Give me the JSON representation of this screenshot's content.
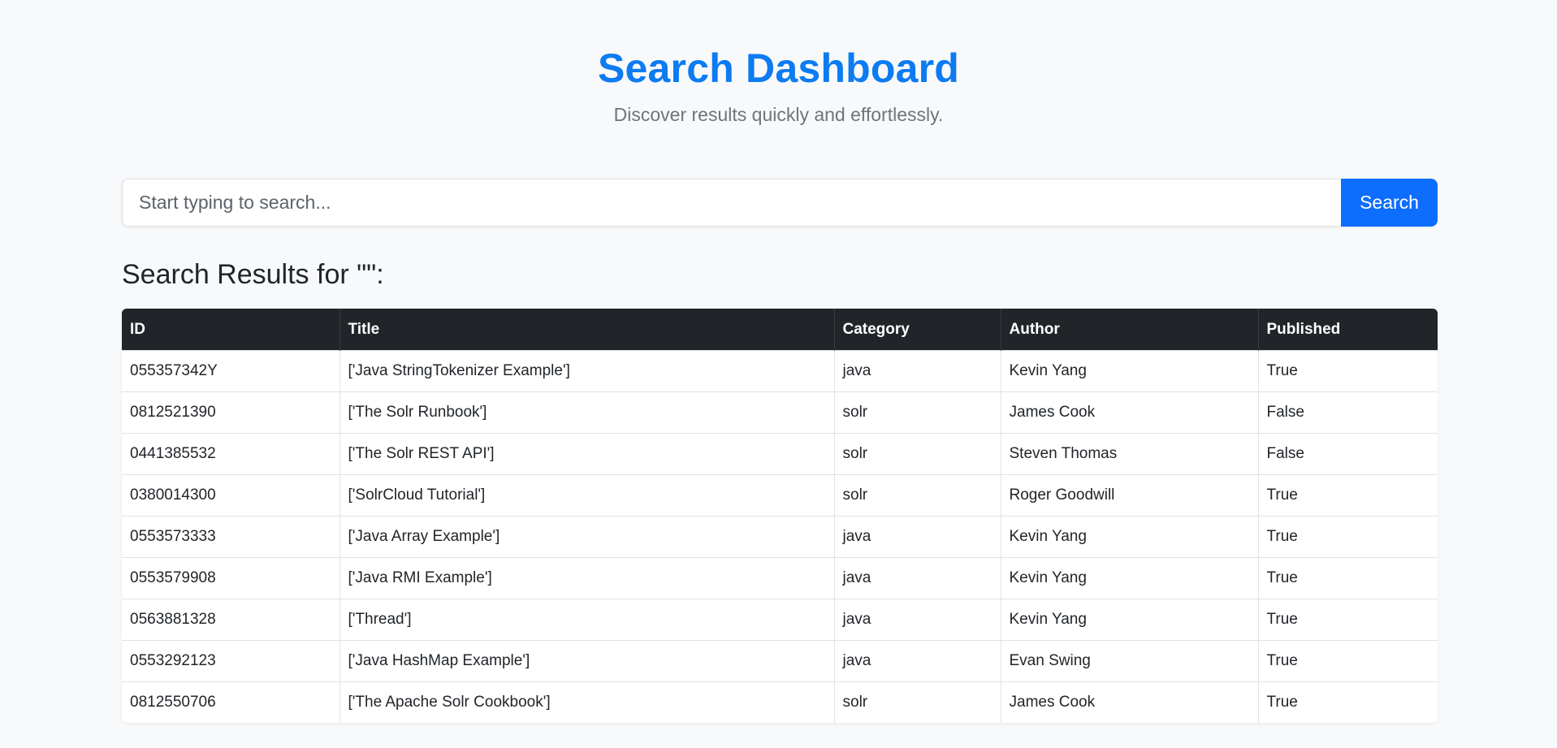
{
  "header": {
    "title": "Search Dashboard",
    "subtitle": "Discover results quickly and effortlessly."
  },
  "search": {
    "placeholder": "Start typing to search...",
    "value": "",
    "button_label": "Search"
  },
  "results": {
    "heading": "Search Results for \"\":",
    "columns": [
      "ID",
      "Title",
      "Category",
      "Author",
      "Published"
    ],
    "rows": [
      [
        "055357342Y",
        "['Java StringTokenizer Example']",
        "java",
        "Kevin Yang",
        "True"
      ],
      [
        "0812521390",
        "['The Solr Runbook']",
        "solr",
        "James Cook",
        "False"
      ],
      [
        "0441385532",
        "['The Solr REST API']",
        "solr",
        "Steven Thomas",
        "False"
      ],
      [
        "0380014300",
        "['SolrCloud Tutorial']",
        "solr",
        "Roger Goodwill",
        "True"
      ],
      [
        "0553573333",
        "['Java Array Example']",
        "java",
        "Kevin Yang",
        "True"
      ],
      [
        "0553579908",
        "['Java RMI Example']",
        "java",
        "Kevin Yang",
        "True"
      ],
      [
        "0563881328",
        "['Thread']",
        "java",
        "Kevin Yang",
        "True"
      ],
      [
        "0553292123",
        "['Java HashMap Example']",
        "java",
        "Evan Swing",
        "True"
      ],
      [
        "0812550706",
        "['The Apache Solr Cookbook']",
        "solr",
        "James Cook",
        "True"
      ]
    ]
  },
  "colors": {
    "title": "#0d7bf1",
    "accent": "#0d6efd",
    "table_header_bg": "#212529",
    "page_bg": "#f8f9fa"
  }
}
